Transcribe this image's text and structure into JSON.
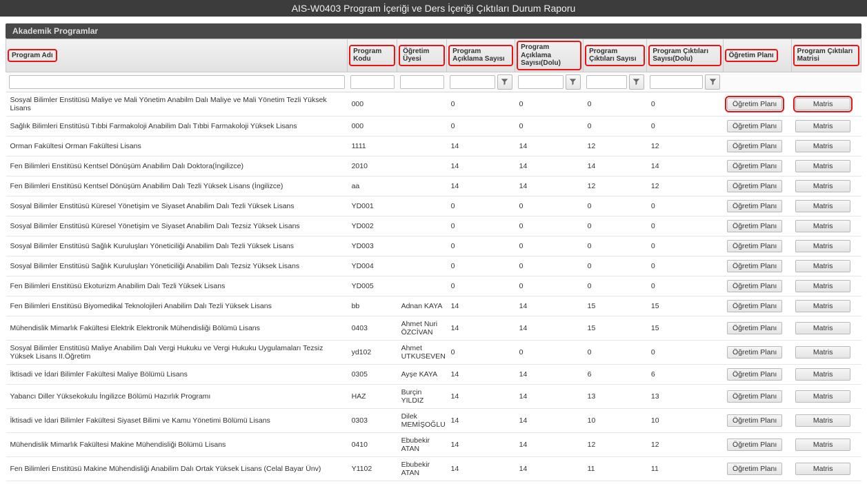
{
  "title": "AIS-W0403 Program İçeriği ve Ders İçeriği Çıktıları Durum Raporu",
  "panel_title": "Akademik Programlar",
  "columns": {
    "name": "Program Adı",
    "code": "Program Kodu",
    "teacher": "Öğretim Üyesi",
    "desc_count": "Program Açıklama Sayısı",
    "desc_count_full": "Program Açıklama Sayısı(Dolu)",
    "out_count": "Program Çıktıları Sayısı",
    "out_count_full": "Program Çıktıları Sayısı(Dolu)",
    "plan": "Öğretim Planı",
    "matrix": "Program Çıktıları Matrisi"
  },
  "buttons": {
    "plan": "Öğretim Planı",
    "matrix": "Matris"
  },
  "rows": [
    {
      "name": "Sosyal Bilimler Enstitüsü Maliye ve Mali Yönetim Anabilm Dalı Maliye ve Mali Yönetim Tezli Yüksek Lisans",
      "code": "000",
      "teacher": "",
      "a": "0",
      "b": "0",
      "c": "0",
      "d": "0",
      "hl": true
    },
    {
      "name": "Sağlık Bilimleri Enstitüsü Tıbbi Farmakoloji Anabilim Dalı Tıbbi Farmakoloji Yüksek Lisans",
      "code": "000",
      "teacher": "",
      "a": "0",
      "b": "0",
      "c": "0",
      "d": "0"
    },
    {
      "name": "Orman Fakültesi Orman Fakültesi Lisans",
      "code": "1111",
      "teacher": "",
      "a": "14",
      "b": "14",
      "c": "12",
      "d": "12"
    },
    {
      "name": "Fen Bilimleri Enstitüsü Kentsel Dönüşüm Anabilim Dalı Doktora(İngilizce)",
      "code": "2010",
      "teacher": "",
      "a": "14",
      "b": "14",
      "c": "14",
      "d": "14"
    },
    {
      "name": "Fen Bilimleri Enstitüsü Kentsel Dönüşüm Anabilim Dalı Tezli Yüksek Lisans (İngilizce)",
      "code": "aa",
      "teacher": "",
      "a": "14",
      "b": "14",
      "c": "12",
      "d": "12"
    },
    {
      "name": "Sosyal Bilimler Enstitüsü Küresel Yönetişim ve Siyaset Anabilim Dalı Tezli Yüksek Lisans",
      "code": "YD001",
      "teacher": "",
      "a": "0",
      "b": "0",
      "c": "0",
      "d": "0"
    },
    {
      "name": "Sosyal Bilimler Enstitüsü Küresel Yönetişim ve Siyaset Anabilim Dalı Tezsiz Yüksek Lisans",
      "code": "YD002",
      "teacher": "",
      "a": "0",
      "b": "0",
      "c": "0",
      "d": "0"
    },
    {
      "name": "Sosyal Bilimler Enstitüsü Sağlık Kuruluşları Yöneticiliği Anabilim Dalı Tezli Yüksek Lisans",
      "code": "YD003",
      "teacher": "",
      "a": "0",
      "b": "0",
      "c": "0",
      "d": "0"
    },
    {
      "name": "Sosyal Bilimler Enstitüsü Sağlık Kuruluşları Yöneticiliği Anabilim Dalı Tezsiz Yüksek Lisans",
      "code": "YD004",
      "teacher": "",
      "a": "0",
      "b": "0",
      "c": "0",
      "d": "0"
    },
    {
      "name": "Fen Bilimleri Enstitüsü Ekoturizm Anabilim Dalı Tezli Yüksek Lisans",
      "code": "YD005",
      "teacher": "",
      "a": "0",
      "b": "0",
      "c": "0",
      "d": "0"
    },
    {
      "name": "Fen Bilimleri Enstitüsü Biyomedikal Teknolojileri Anabilim Dalı Tezli Yüksek Lisans",
      "code": "bb",
      "teacher": "Adnan KAYA",
      "a": "14",
      "b": "14",
      "c": "15",
      "d": "15"
    },
    {
      "name": "Mühendislik Mimarlık Fakültesi Elektrik Elektronik Mühendisliği Bölümü Lisans",
      "code": "0403",
      "teacher": "Ahmet Nuri ÖZCİVAN",
      "a": "14",
      "b": "14",
      "c": "15",
      "d": "15"
    },
    {
      "name": "Sosyal Bilimler Enstitüsü Maliye Anabilim Dalı Vergi Hukuku ve Vergi Hukuku Uygulamaları Tezsiz Yüksek Lisans II.Öğretim",
      "code": "yd102",
      "teacher": "Ahmet UTKUSEVEN",
      "a": "0",
      "b": "0",
      "c": "0",
      "d": "0"
    },
    {
      "name": "İktisadi ve İdari Bilimler Fakültesi Maliye Bölümü Lisans",
      "code": "0305",
      "teacher": "Ayşe KAYA",
      "a": "14",
      "b": "14",
      "c": "6",
      "d": "6"
    },
    {
      "name": "Yabancı Diller Yüksekokulu İngilizce Bölümü Hazırlık Programı",
      "code": "HAZ",
      "teacher": "Burçin YILDIZ",
      "a": "14",
      "b": "14",
      "c": "13",
      "d": "13"
    },
    {
      "name": "İktisadi ve İdari Bilimler Fakültesi Siyaset Bilimi ve Kamu Yönetimi Bölümü Lisans",
      "code": "0303",
      "teacher": "Dilek MEMİŞOĞLU",
      "a": "14",
      "b": "14",
      "c": "10",
      "d": "10"
    },
    {
      "name": "Mühendislik Mimarlık Fakültesi Makine Mühendisliği Bölümü Lisans",
      "code": "0410",
      "teacher": "Ebubekir ATAN",
      "a": "14",
      "b": "14",
      "c": "12",
      "d": "12"
    },
    {
      "name": "Fen Bilimleri Enstitüsü Makine Mühendisliği Anabilim Dalı Ortak Yüksek Lisans (Celal Bayar Ünv)",
      "code": "Y1102",
      "teacher": "Ebubekir ATAN",
      "a": "14",
      "b": "14",
      "c": "11",
      "d": "11"
    }
  ]
}
